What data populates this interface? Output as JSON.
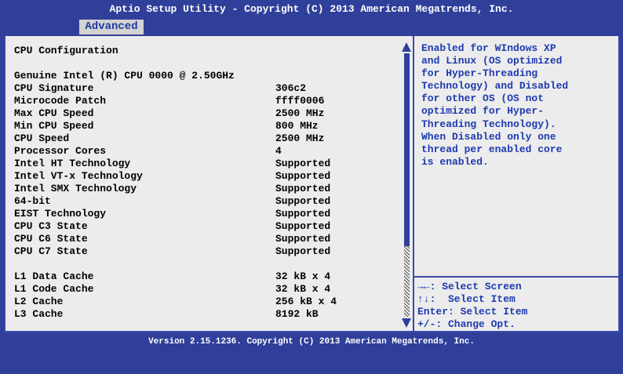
{
  "header": {
    "title": "Aptio Setup Utility - Copyright (C) 2013 American Megatrends, Inc.",
    "tabs": [
      {
        "label": "Advanced"
      }
    ]
  },
  "main": {
    "section_title": "CPU Configuration",
    "processor_name": "Genuine Intel (R) CPU 0000 @ 2.50GHz",
    "items": [
      {
        "label": "CPU Signature",
        "value": "306c2"
      },
      {
        "label": "Microcode Patch",
        "value": "ffff0006"
      },
      {
        "label": "Max CPU Speed",
        "value": "2500 MHz"
      },
      {
        "label": "Min CPU Speed",
        "value": "800 MHz"
      },
      {
        "label": "CPU Speed",
        "value": "2500 MHz"
      },
      {
        "label": "Processor Cores",
        "value": "4"
      },
      {
        "label": "Intel HT Technology",
        "value": "Supported"
      },
      {
        "label": "Intel VT-x Technology",
        "value": "Supported"
      },
      {
        "label": "Intel SMX Technology",
        "value": "Supported"
      },
      {
        "label": "64-bit",
        "value": "Supported"
      },
      {
        "label": "EIST Technology",
        "value": "Supported"
      },
      {
        "label": "CPU C3 State",
        "value": "Supported"
      },
      {
        "label": "CPU C6 State",
        "value": "Supported"
      },
      {
        "label": "CPU C7 State",
        "value": "Supported"
      }
    ],
    "cache": [
      {
        "label": "L1 Data Cache",
        "value": "32 kB x 4"
      },
      {
        "label": "L1 Code Cache",
        "value": "32 kB x 4"
      },
      {
        "label": "L2 Cache",
        "value": "256 kB x 4"
      },
      {
        "label": "L3 Cache",
        "value": "8192 kB"
      }
    ]
  },
  "help": {
    "lines": [
      "Enabled for WIndows XP",
      "and Linux (OS optimized",
      "for Hyper-Threading",
      "Technology) and Disabled",
      "for other OS (OS not",
      "optimized for Hyper-",
      "Threading Technology).",
      "When Disabled only one",
      "thread per enabled core",
      "is enabled."
    ],
    "keys": [
      "→←: Select Screen",
      "↑↓:  Select Item",
      "Enter: Select Item",
      "+/-: Change Opt."
    ]
  },
  "footer": {
    "text": "Version 2.15.1236. Copyright (C) 2013 American Megatrends, Inc."
  },
  "colors": {
    "background": "#2f3f9a",
    "panel": "#ececec",
    "help_text": "#1e3ab0",
    "tab_bg": "#d3d3d3"
  }
}
